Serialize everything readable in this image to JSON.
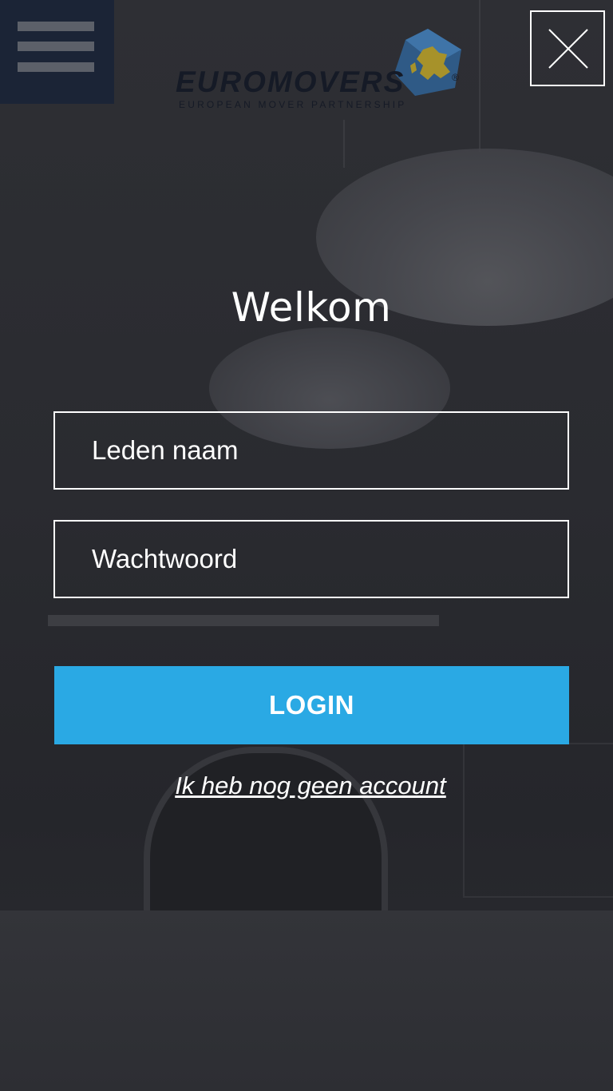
{
  "header": {
    "menu_icon": "hamburger-menu-icon",
    "close_icon": "close-icon",
    "logo": {
      "wordmark": "EUROMOVERS",
      "tagline": "EUROPEAN MOVER PARTNERSHIP",
      "registered": "®"
    }
  },
  "main": {
    "title": "Welkom",
    "username_placeholder": "Leden naam",
    "password_placeholder": "Wachtwoord",
    "login_label": "LOGIN",
    "register_link": "Ik heb nog geen account"
  },
  "colors": {
    "accent": "#2aa9e4",
    "menu_background": "#1b2436",
    "page_background": "#2b2c31"
  }
}
